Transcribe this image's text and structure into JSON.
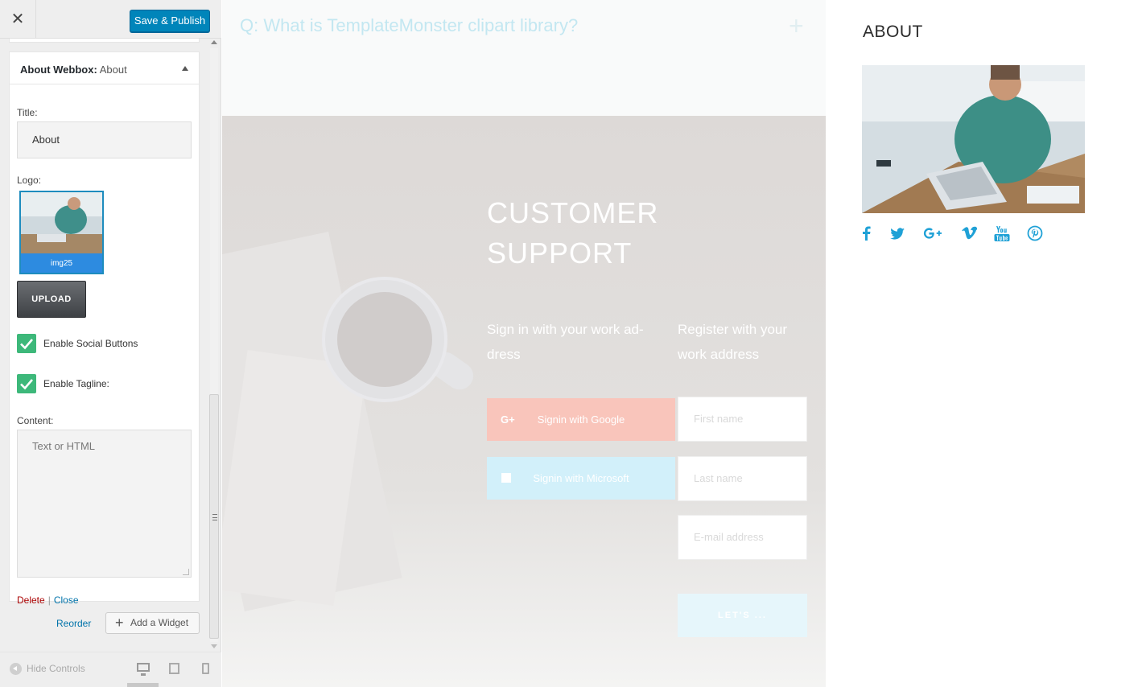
{
  "customizer": {
    "close_glyph": "✕",
    "save_label": "Save & Publish",
    "widget": {
      "title_bold": "About Webbox:",
      "title_instance": "About",
      "title_label": "Title:",
      "title_value": "About",
      "logo_label": "Logo:",
      "logo_filename": "img25",
      "upload_label": "UPLOAD",
      "social_label": "Enable Social Buttons",
      "social_checked": true,
      "tagline_label": "Enable Tagline:",
      "tagline_checked": true,
      "content_label": "Content:",
      "content_placeholder": "Text or HTML",
      "delete_label": "Delete",
      "separator": "|",
      "close_label": "Close"
    },
    "reorder_label": "Reorder",
    "add_widget_label": "Add a Widget",
    "hide_controls_label": "Hide Controls",
    "active_device": "desktop"
  },
  "preview": {
    "faq_question": "Q: What is TemplateMonster clipart library?",
    "faq_toggle": "+",
    "support": {
      "title": "CUSTOMER SUPPORT",
      "signin_text": "Sign in with your work ad-dress",
      "register_text": "Register with your work address",
      "google_icon": "G+",
      "google_label": "Signin with Google",
      "microsoft_label": "Signin with Microsoft",
      "first_name_placeholder": "First name",
      "last_name_placeholder": "Last name",
      "email_placeholder": "E-mail address",
      "submit_label": "LET'S ..."
    }
  },
  "about": {
    "title": "ABOUT",
    "social_icons": [
      "facebook-icon",
      "twitter-icon",
      "google-plus-icon",
      "vimeo-icon",
      "youtube-icon",
      "pinterest-icon"
    ]
  },
  "colors": {
    "wp_primary": "#0085ba",
    "checkbox_green": "#3db87a",
    "social_blue": "#1fa1d6",
    "google_button": "#f9c5bb",
    "microsoft_button": "#d2f0fa"
  }
}
